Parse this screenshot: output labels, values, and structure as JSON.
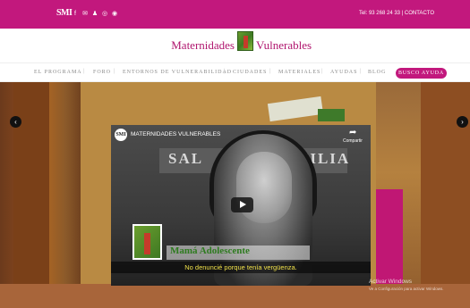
{
  "topbar": {
    "brand": "SMI",
    "social_icons": [
      "f",
      "✉",
      "♟",
      "◎",
      "◉"
    ],
    "contact": "Tel: 93 268 24 33 | CONTACTO"
  },
  "header": {
    "title_left": "Maternidades",
    "title_right": "Vulnerables"
  },
  "nav": {
    "items": [
      "EL PROGRAMA",
      "FORO",
      "ENTORNOS DE VULNERABILIDAD",
      "CIUDADES",
      "MATERIALES",
      "AYUDAS",
      "BLOG"
    ],
    "separator": "|",
    "cta": "BUSCO AYUDA"
  },
  "slider": {
    "prev": "‹",
    "next": "›"
  },
  "video": {
    "channel_logo": "SMI",
    "channel_name": "MATERNIDADES VULNERABLES",
    "share_label": "Compartir",
    "sign_left": "SAL",
    "sign_right": "AMILIA",
    "title": "Mamá Adolescente",
    "subtitle": "No denuncié porque tenía vergüenza."
  },
  "watermark": {
    "line1": "Activar Windows",
    "line2": "Ve a Configuración para activar Windows."
  }
}
